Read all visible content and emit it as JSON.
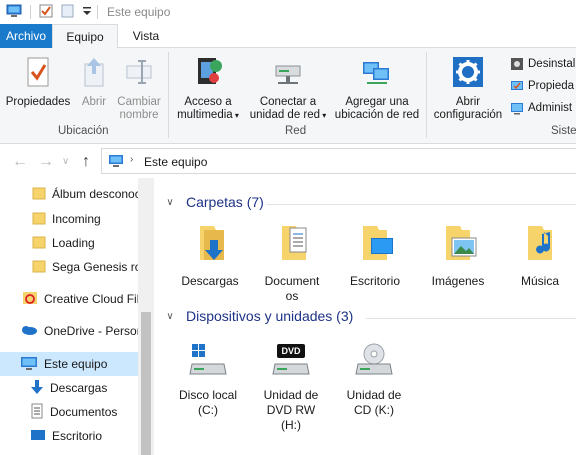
{
  "window": {
    "title": "Este equipo"
  },
  "ribbon": {
    "tabs": [
      "Archivo",
      "Equipo",
      "Vista"
    ],
    "buttons": {
      "propiedades": "Propiedades",
      "abrir": "Abrir",
      "cambiar_nombre_1": "Cambiar",
      "cambiar_nombre_2": "nombre",
      "acceso_1": "Acceso a",
      "acceso_2": "multimedia",
      "conectar_1": "Conectar a",
      "conectar_2": "unidad de red",
      "agregar_1": "Agregar una",
      "agregar_2": "ubicación de red",
      "abrir_conf_1": "Abrir",
      "abrir_conf_2": "configuración"
    },
    "small_buttons": [
      "Desinstal",
      "Propieda",
      "Administ"
    ],
    "groups": [
      "Ubicación",
      "Red",
      "Siste"
    ]
  },
  "address": {
    "path": "Este equipo"
  },
  "nav_items": [
    "Álbum desconocido",
    "Incoming",
    "Loading",
    "Sega Genesis rom",
    "Creative Cloud Files",
    "OneDrive - Personal",
    "Este equipo",
    "Descargas",
    "Documentos",
    "Escritorio"
  ],
  "sections": {
    "carpetas": "Carpetas (7)",
    "dispositivos": "Dispositivos y unidades (3)"
  },
  "folders": [
    {
      "label": "Descargas"
    },
    {
      "label1": "Document",
      "label2": "os"
    },
    {
      "label": "Escritorio"
    },
    {
      "label": "Imágenes"
    },
    {
      "label": "Música"
    }
  ],
  "drives": [
    {
      "label1": "Disco local",
      "label2": "(C:)"
    },
    {
      "label1": "Unidad de",
      "label2": "DVD RW",
      "label3": "(H:)",
      "badge": "DVD"
    },
    {
      "label1": "Unidad de",
      "label2": "CD (K:)"
    }
  ],
  "colors": {
    "accent": "#1979ca",
    "selection": "#cce8ff",
    "folder": "#f6d46b",
    "section_text": "#1e3287"
  }
}
